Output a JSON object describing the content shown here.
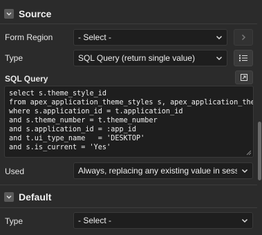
{
  "source": {
    "title": "Source",
    "form_region": {
      "label": "Form Region",
      "value": "- Select -"
    },
    "type": {
      "label": "Type",
      "value": "SQL Query (return single value)"
    },
    "sql_query": {
      "label": "SQL Query",
      "lines": [
        "select s.theme_style_id",
        "from apex_application_theme_styles s, apex_application_themes t",
        "where s.application_id = t.application_id",
        "and s.theme_number = t.theme_number",
        "and s.application_id = :app_id",
        "and t.ui_type_name   = 'DESKTOP'",
        "and s.is_current = 'Yes'"
      ]
    },
    "used": {
      "label": "Used",
      "value": "Always, replacing any existing value in session state"
    }
  },
  "default": {
    "title": "Default",
    "type": {
      "label": "Type",
      "value": "- Select -"
    }
  },
  "icons": {
    "collapse": "chevron-down-icon",
    "go_to": "chevron-right-icon",
    "list": "list-icon",
    "expand_editor": "expand-icon",
    "dropdown": "chevron-down-icon"
  },
  "colors": {
    "background": "#2b2b2b",
    "field": "#1e1e1e",
    "border": "#3a3a3a",
    "text": "#e8e8e8"
  }
}
